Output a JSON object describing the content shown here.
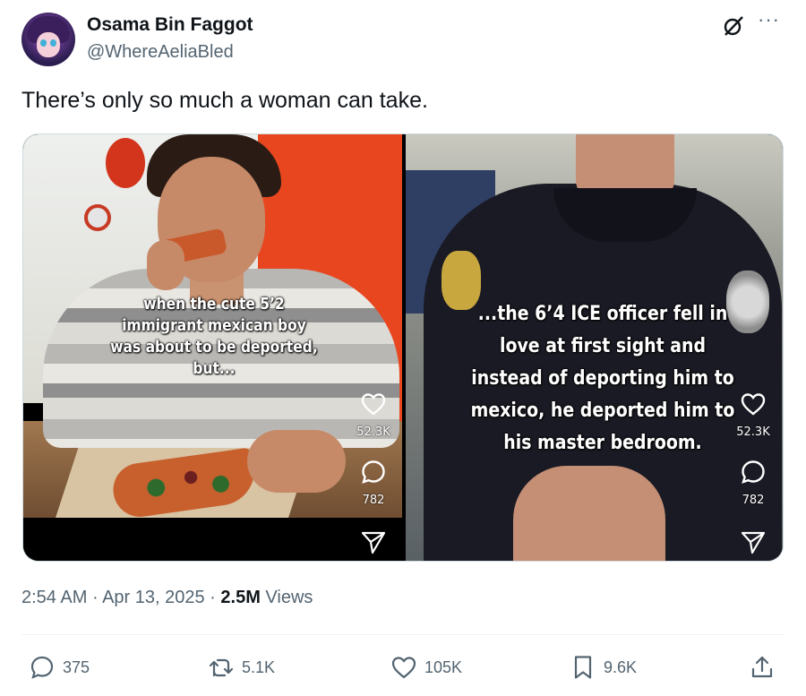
{
  "author": {
    "display_name": "Osama Bin Faggot",
    "handle": "@WhereAeliaBled"
  },
  "post": {
    "text": "There’s only so much a woman can take.",
    "time": "2:54 AM",
    "date": "Apr 13, 2025",
    "views_count": "2.5M",
    "views_label": "Views"
  },
  "media": {
    "left": {
      "caption": "when the cute 5’2 immigrant mexican boy was about to be deported, but...",
      "likes": "52.3K",
      "comments": "782"
    },
    "right": {
      "caption": "...the 6’4 ICE officer fell in love at first sight and instead of deporting him to mexico, he deported him to his master bedroom.",
      "likes": "52.3K",
      "comments": "782"
    }
  },
  "actions": {
    "replies": "375",
    "reposts": "5.1K",
    "likes": "105K",
    "bookmarks": "9.6K"
  },
  "colors": {
    "text_primary": "#0f1419",
    "text_secondary": "#536471",
    "divider": "#eff3f4"
  },
  "icons": [
    "grok-icon",
    "more-icon",
    "reply-icon",
    "repost-icon",
    "like-icon",
    "bookmark-icon",
    "share-icon",
    "heart-outline-icon",
    "comment-icon",
    "send-icon"
  ]
}
